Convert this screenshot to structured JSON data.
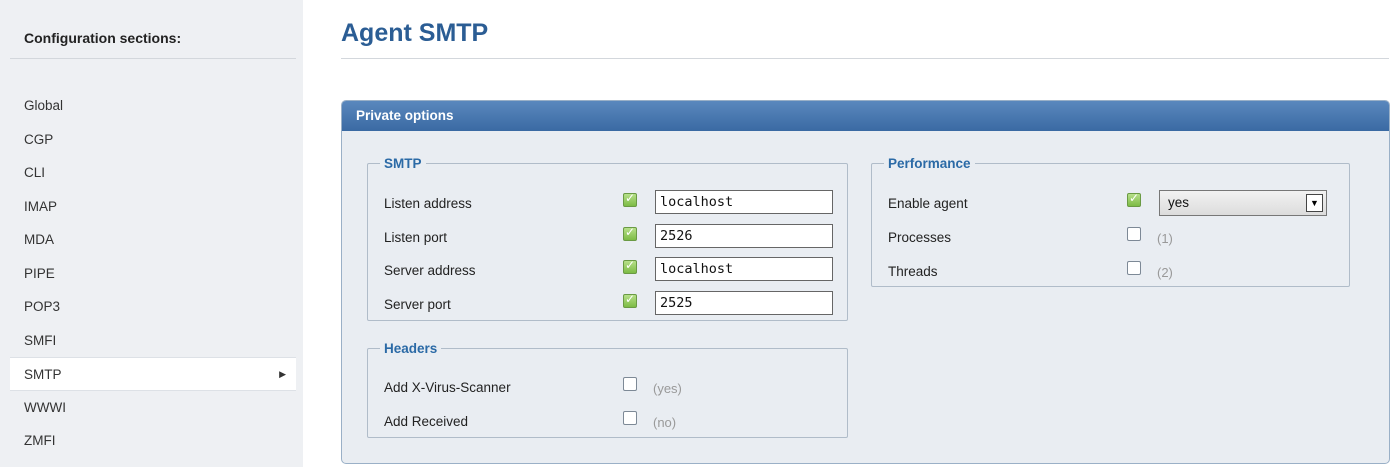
{
  "sidebar": {
    "title": "Configuration sections:",
    "items": [
      {
        "label": "Global"
      },
      {
        "label": "CGP"
      },
      {
        "label": "CLI"
      },
      {
        "label": "IMAP"
      },
      {
        "label": "MDA"
      },
      {
        "label": "PIPE"
      },
      {
        "label": "POP3"
      },
      {
        "label": "SMFI"
      },
      {
        "label": "SMTP",
        "active": true,
        "arrow": "▶"
      },
      {
        "label": "WWWI"
      },
      {
        "label": "ZMFI"
      }
    ]
  },
  "main": {
    "title": "Agent SMTP",
    "panel": {
      "header": "Private options",
      "smtp": {
        "legend": "SMTP",
        "rows": [
          {
            "label": "Listen address",
            "checked": true,
            "value": "localhost"
          },
          {
            "label": "Listen port",
            "checked": true,
            "value": "2526"
          },
          {
            "label": "Server address",
            "checked": true,
            "value": "localhost"
          },
          {
            "label": "Server port",
            "checked": true,
            "value": "2525"
          }
        ]
      },
      "headers": {
        "legend": "Headers",
        "rows": [
          {
            "label": "Add X-Virus-Scanner",
            "checked": false,
            "default": "(yes)"
          },
          {
            "label": "Add Received",
            "checked": false,
            "default": "(no)"
          }
        ]
      },
      "performance": {
        "legend": "Performance",
        "enable_agent": {
          "label": "Enable agent",
          "checked": true,
          "value": "yes",
          "dropdown_icon": "▼"
        },
        "rows": [
          {
            "label": "Processes",
            "checked": false,
            "default": "(1)"
          },
          {
            "label": "Threads",
            "checked": false,
            "default": "(2)"
          }
        ]
      }
    }
  },
  "colors": {
    "accent": "#2b5d94",
    "legend": "#2b6aa6",
    "panel_header": "#3a6aa3",
    "checkbox_checked": "#7dbb45"
  }
}
